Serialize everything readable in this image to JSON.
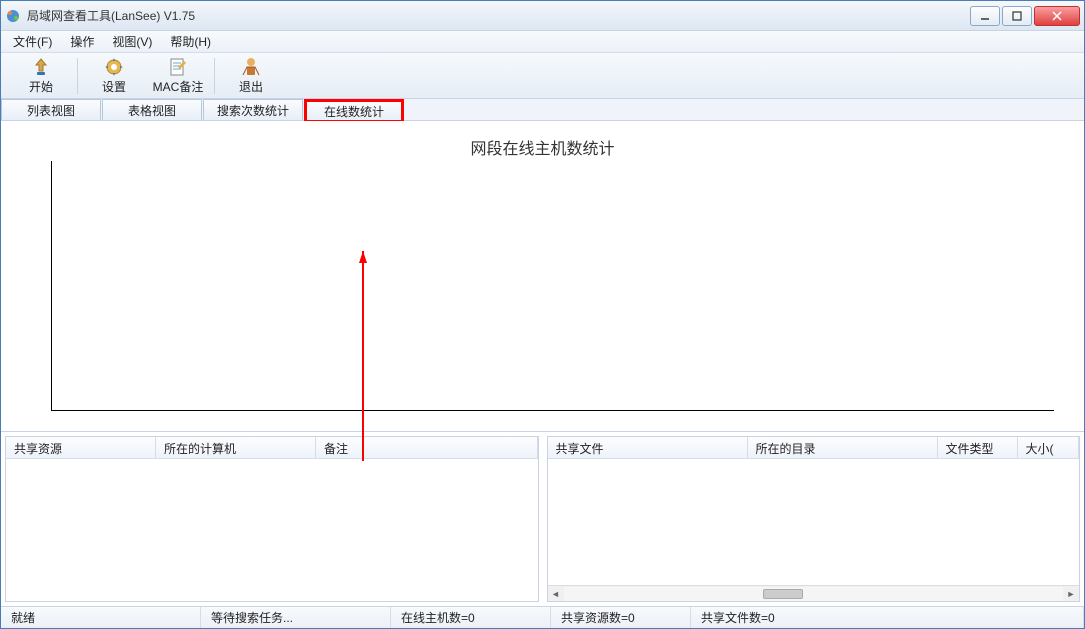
{
  "window": {
    "title": "局域网查看工具(LanSee) V1.75"
  },
  "menu": {
    "file": "文件(F)",
    "operate": "操作",
    "view": "视图(V)",
    "help": "帮助(H)"
  },
  "toolbar": {
    "start": "开始",
    "settings": "设置",
    "mac_note": "MAC备注",
    "exit": "退出"
  },
  "tabs": {
    "list_view": "列表视图",
    "table_view": "表格视图",
    "search_count": "搜索次数统计",
    "online_count": "在线数统计"
  },
  "chart_data": {
    "type": "line",
    "title": "网段在线主机数统计",
    "categories": [],
    "values": [],
    "xlabel": "",
    "ylabel": "",
    "series": []
  },
  "left_panel": {
    "columns": {
      "shared_resource": "共享资源",
      "computer": "所在的计算机",
      "note": "备注"
    }
  },
  "right_panel": {
    "columns": {
      "shared_file": "共享文件",
      "directory": "所在的目录",
      "file_type": "文件类型",
      "size": "大小("
    }
  },
  "status": {
    "ready": "就绪",
    "waiting": "等待搜索任务...",
    "online_hosts": "在线主机数=0",
    "shared_resources": "共享资源数=0",
    "shared_files": "共享文件数=0"
  }
}
